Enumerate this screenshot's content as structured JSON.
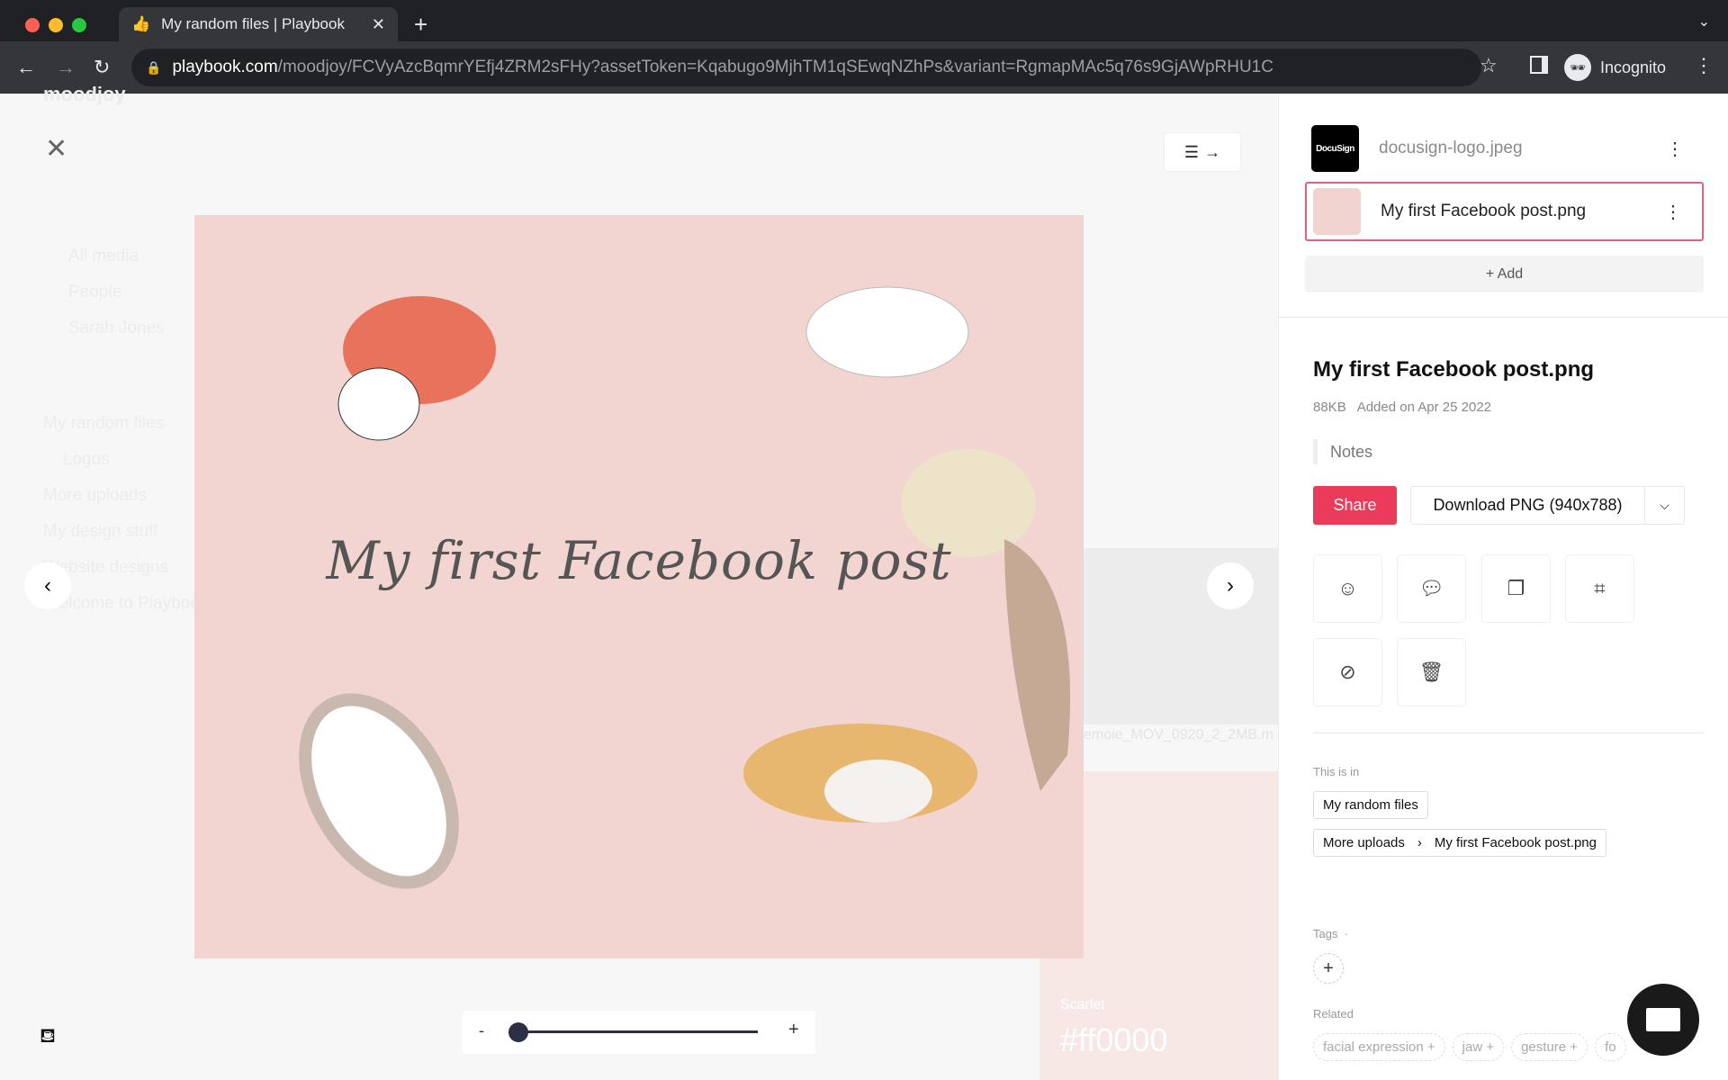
{
  "browser": {
    "tab_title": "My random files | Playbook",
    "url_host": "playbook.com",
    "url_rest": "/moodjoy/FCVyAzcBqmrYEfj4ZRM2sFHy?assetToken=Kqabugo9MjhTM1qSEwqNZhPs&variant=RgmapMAc5q76s9GjAWpRHU1C",
    "profile": "Incognito"
  },
  "background": {
    "workspace": "moodjoy",
    "sidebar": [
      "All media",
      "People",
      "Sarah Jones",
      "My random files",
      "Logos",
      "More uploads",
      "My design stuff",
      "Website designs",
      "Welcome to Playbook"
    ],
    "card_filename": "emoie_MOV_0920_2_2MB.m",
    "color_label": "Scarlet",
    "color_hex": "#ff0000"
  },
  "viewer": {
    "image_caption": "My first Facebook post",
    "zoom_minus": "-",
    "zoom_plus": "+",
    "zoom_level": 0
  },
  "panel": {
    "assets": [
      {
        "name": "docusign-logo.jpeg",
        "thumb_text": "DocuSign"
      },
      {
        "name": "My first Facebook post.png",
        "selected": true
      }
    ],
    "add_label": "+ Add",
    "title": "My first Facebook post.png",
    "size": "88KB",
    "added": "Added on Apr 25 2022",
    "notes_placeholder": "Notes",
    "share_label": "Share",
    "download_label": "Download PNG (940x788)",
    "actions": [
      "add-reaction-icon",
      "comment-icon",
      "copy-icon",
      "crop-icon",
      "hide-icon",
      "trash-icon"
    ],
    "this_is_in_label": "This is in",
    "locations": [
      {
        "path": [
          "My random files"
        ]
      },
      {
        "path": [
          "More uploads",
          "My first Facebook post.png"
        ]
      }
    ],
    "tags_label": "Tags",
    "tags_dot": "·",
    "related_label": "Related",
    "related": [
      "facial expression +",
      "jaw +",
      "gesture +",
      "fo"
    ]
  },
  "colors": {
    "accent": "#ea3b5a",
    "selected_border": "#e0607e",
    "image_bg": "#f2d4d0"
  }
}
